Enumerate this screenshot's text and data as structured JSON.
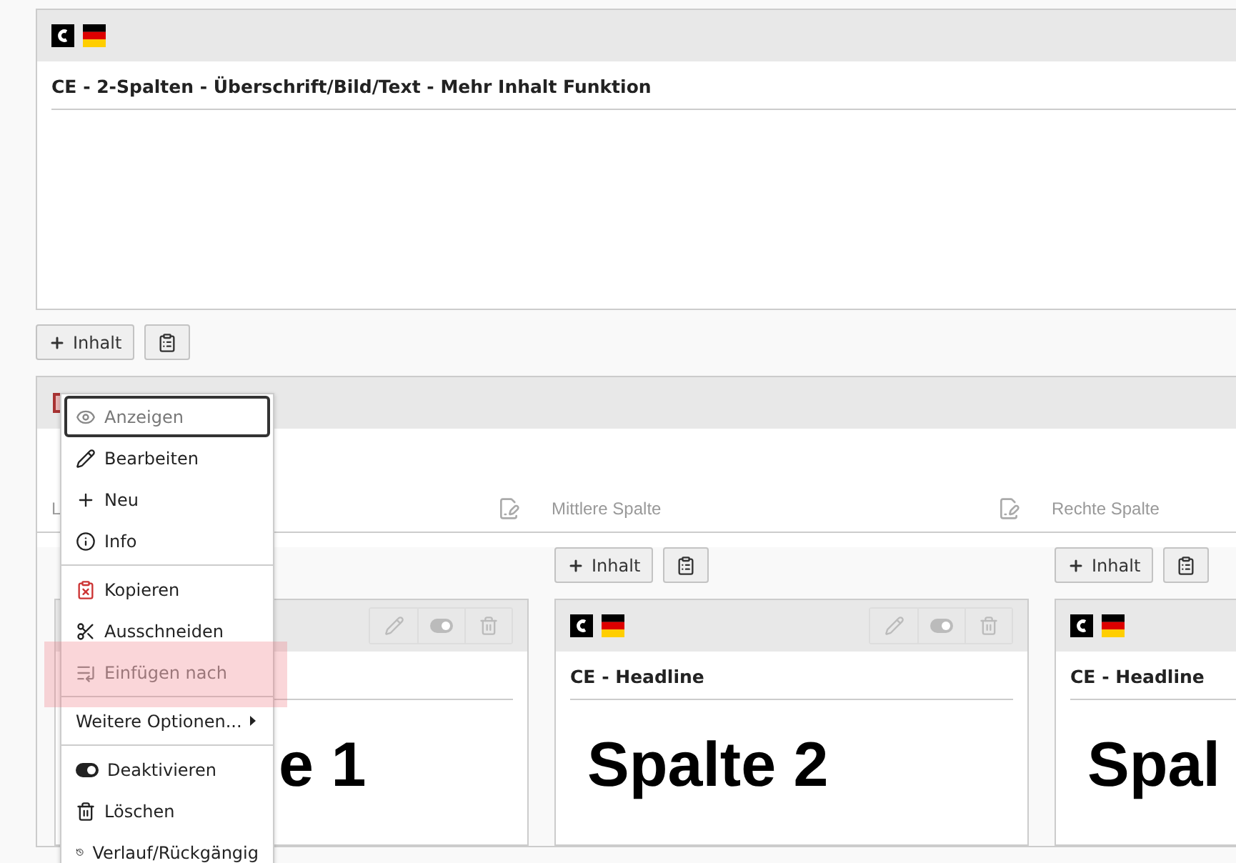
{
  "top_element": {
    "title": "CE - 2-Spalten - Überschrift/Bild/Text - Mehr Inhalt Funktion",
    "add_label": "Inhalt"
  },
  "grid_element": {
    "columns": [
      {
        "label": "L",
        "cards": [
          {
            "body": "e 1",
            "kind": "partial"
          }
        ]
      },
      {
        "label": "Mittlere Spalte",
        "add_label": "Inhalt",
        "cards": [
          {
            "title": "CE - Headline",
            "body": "Spalte 2",
            "kind": "full"
          }
        ]
      },
      {
        "label": "Rechte Spalte",
        "add_label": "Inhalt",
        "cards": [
          {
            "title": "CE - Headline",
            "body": "Spal",
            "kind": "full"
          }
        ]
      }
    ]
  },
  "context_menu": {
    "items": [
      {
        "kind": "item",
        "label": "Anzeigen",
        "disabled": true,
        "focused": true,
        "highlighted": false
      },
      {
        "kind": "item",
        "label": "Bearbeiten",
        "disabled": false,
        "focused": false,
        "highlighted": false
      },
      {
        "kind": "item",
        "label": "Neu",
        "disabled": false,
        "focused": false,
        "highlighted": false
      },
      {
        "kind": "item",
        "label": "Info",
        "disabled": false,
        "focused": false,
        "highlighted": false
      },
      {
        "kind": "divider"
      },
      {
        "kind": "item",
        "label": "Kopieren",
        "disabled": false,
        "focused": false,
        "highlighted": false
      },
      {
        "kind": "item",
        "label": "Ausschneiden",
        "disabled": false,
        "focused": false,
        "highlighted": false
      },
      {
        "kind": "item",
        "label": "Einfügen nach",
        "disabled": true,
        "focused": false,
        "highlighted": true
      },
      {
        "kind": "divider"
      },
      {
        "kind": "submenu",
        "label": "Weitere Optionen..."
      },
      {
        "kind": "divider"
      },
      {
        "kind": "item",
        "label": "Deaktivieren",
        "disabled": false,
        "focused": false,
        "highlighted": false
      },
      {
        "kind": "item",
        "label": "Löschen",
        "disabled": false,
        "focused": false,
        "highlighted": false
      },
      {
        "kind": "item",
        "label": "Verlauf/Rückgängig",
        "disabled": false,
        "focused": false,
        "highlighted": false
      }
    ]
  }
}
